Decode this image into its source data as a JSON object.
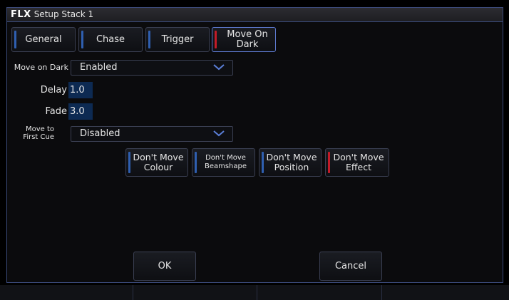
{
  "window": {
    "logo": "FLX",
    "title": "Setup Stack 1"
  },
  "tabs": [
    {
      "label": "General",
      "active": false
    },
    {
      "label": "Chase",
      "active": false
    },
    {
      "label": "Trigger",
      "active": false
    },
    {
      "label": "Move On Dark",
      "active": true
    }
  ],
  "move_on_dark": {
    "label": "Move on Dark",
    "value": "Enabled"
  },
  "delay": {
    "label": "Delay",
    "value": "1.0"
  },
  "fade": {
    "label": "Fade",
    "value": "3.0"
  },
  "move_to_first_cue": {
    "label": "Move to First Cue",
    "value": "Disabled"
  },
  "dont_move": [
    {
      "label": "Don't Move Colour"
    },
    {
      "label": "Don't Move Beamshape"
    },
    {
      "label": "Don't Move Position"
    },
    {
      "label": "Don't Move Effect"
    }
  ],
  "actions": {
    "ok": "OK",
    "cancel": "Cancel"
  },
  "colors": {
    "accent_blue": "#2f5fb0",
    "accent_red": "#c31b28",
    "field_bg": "#0d2a52"
  }
}
